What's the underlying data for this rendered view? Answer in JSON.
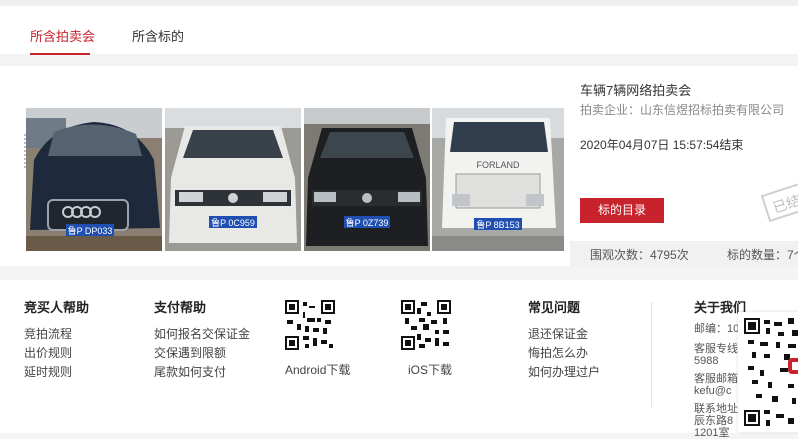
{
  "tabs": {
    "items": [
      {
        "label": "所含拍卖会"
      },
      {
        "label": "所含标的"
      }
    ]
  },
  "auction": {
    "title": "车辆7辆网络拍卖会",
    "company_label": "拍卖企业：",
    "company_name": "山东信煜招标拍卖有限公司",
    "end_time": "2020年04月07日  15:57:54结束",
    "catalog_button": "标的目录",
    "stamp": "已结",
    "views_label": "围观次数：",
    "views": "4795次",
    "lots_label": "标的数量：",
    "lots": "7个",
    "photos": [
      {
        "plate": "鲁P DP033"
      },
      {
        "plate": "鲁P 0C959"
      },
      {
        "plate": "鲁P 0Z739"
      },
      {
        "plate": "鲁P 8B153"
      }
    ],
    "truck_brand": "FORLAND"
  },
  "footer": {
    "bidder_help": {
      "title": "竞买人帮助",
      "links": [
        "竞拍流程",
        "出价规则",
        "延时规则"
      ]
    },
    "pay_help": {
      "title": "支付帮助",
      "links": [
        "如何报名交保证金",
        "交保遇到限额",
        "尾款如何支付"
      ]
    },
    "android_label": "Android下载",
    "ios_label": "iOS下载",
    "faq": {
      "title": "常见问题",
      "links": [
        "退还保证金",
        "悔拍怎么办",
        "如何办理过户"
      ]
    },
    "about": {
      "title": "关于我们",
      "lines": [
        "邮编：10",
        "客服专线",
        "5988",
        "客服邮箱",
        "kefu@c",
        "联系地址",
        "辰东路8",
        "1201室"
      ]
    }
  }
}
